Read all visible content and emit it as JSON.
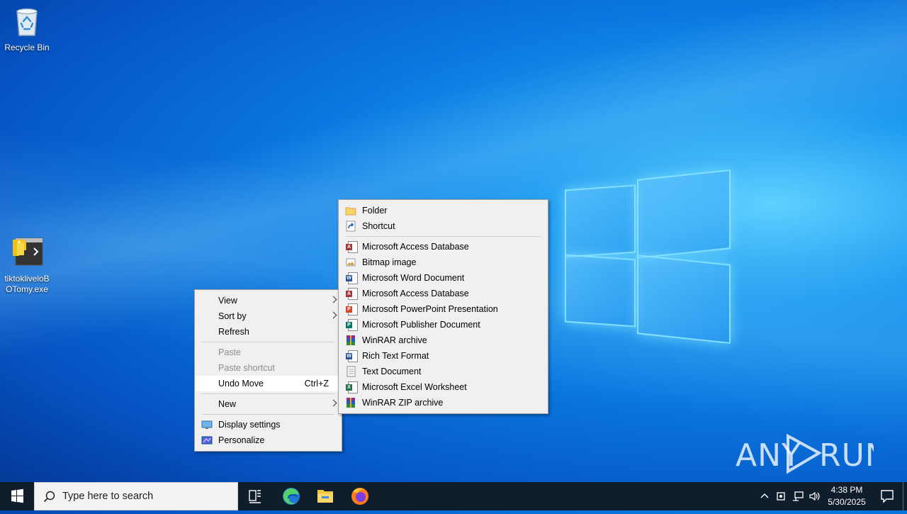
{
  "desktop": {
    "icons": [
      {
        "label": "Recycle Bin"
      },
      {
        "label": "tiktokliveloBOTomy.exe",
        "line1": "tiktokliveloB",
        "line2": "OTomy.exe"
      }
    ]
  },
  "context_menu": {
    "items": [
      {
        "label": "View",
        "submenu": true
      },
      {
        "label": "Sort by",
        "submenu": true
      },
      {
        "label": "Refresh"
      },
      {
        "label": "Paste",
        "disabled": true
      },
      {
        "label": "Paste shortcut",
        "disabled": true
      },
      {
        "label": "Undo Move",
        "shortcut": "Ctrl+Z",
        "highlighted": true
      },
      {
        "label": "New",
        "submenu": true
      },
      {
        "label": "Display settings",
        "icon": "display-icon"
      },
      {
        "label": "Personalize",
        "icon": "personalize-icon"
      }
    ]
  },
  "new_submenu": {
    "items": [
      {
        "label": "Folder",
        "icon": "folder-icon"
      },
      {
        "label": "Shortcut",
        "icon": "shortcut-icon"
      },
      {
        "label": "Microsoft Access Database",
        "icon": "access-icon"
      },
      {
        "label": "Bitmap image",
        "icon": "bitmap-icon"
      },
      {
        "label": "Microsoft Word Document",
        "icon": "word-icon"
      },
      {
        "label": "Microsoft Access Database",
        "icon": "access-icon"
      },
      {
        "label": "Microsoft PowerPoint Presentation",
        "icon": "powerpoint-icon"
      },
      {
        "label": "Microsoft Publisher Document",
        "icon": "publisher-icon"
      },
      {
        "label": "WinRAR archive",
        "icon": "winrar-icon"
      },
      {
        "label": "Rich Text Format",
        "icon": "rtf-icon"
      },
      {
        "label": "Text Document",
        "icon": "text-doc-icon"
      },
      {
        "label": "Microsoft Excel Worksheet",
        "icon": "excel-icon"
      },
      {
        "label": "WinRAR ZIP archive",
        "icon": "winrar-zip-icon"
      }
    ]
  },
  "taskbar": {
    "search_placeholder": "Type here to search",
    "pinned": [
      "task-view-icon",
      "edge-icon",
      "file-explorer-icon",
      "firefox-icon"
    ],
    "clock": {
      "time": "4:38 PM",
      "date": "5/30/2025"
    }
  },
  "watermark": "ANY RUN",
  "colors": {
    "access": "#a4373a",
    "word": "#2b579a",
    "powerpoint": "#d24726",
    "publisher": "#077568",
    "excel": "#217346",
    "taskbar": "#101d2c"
  }
}
